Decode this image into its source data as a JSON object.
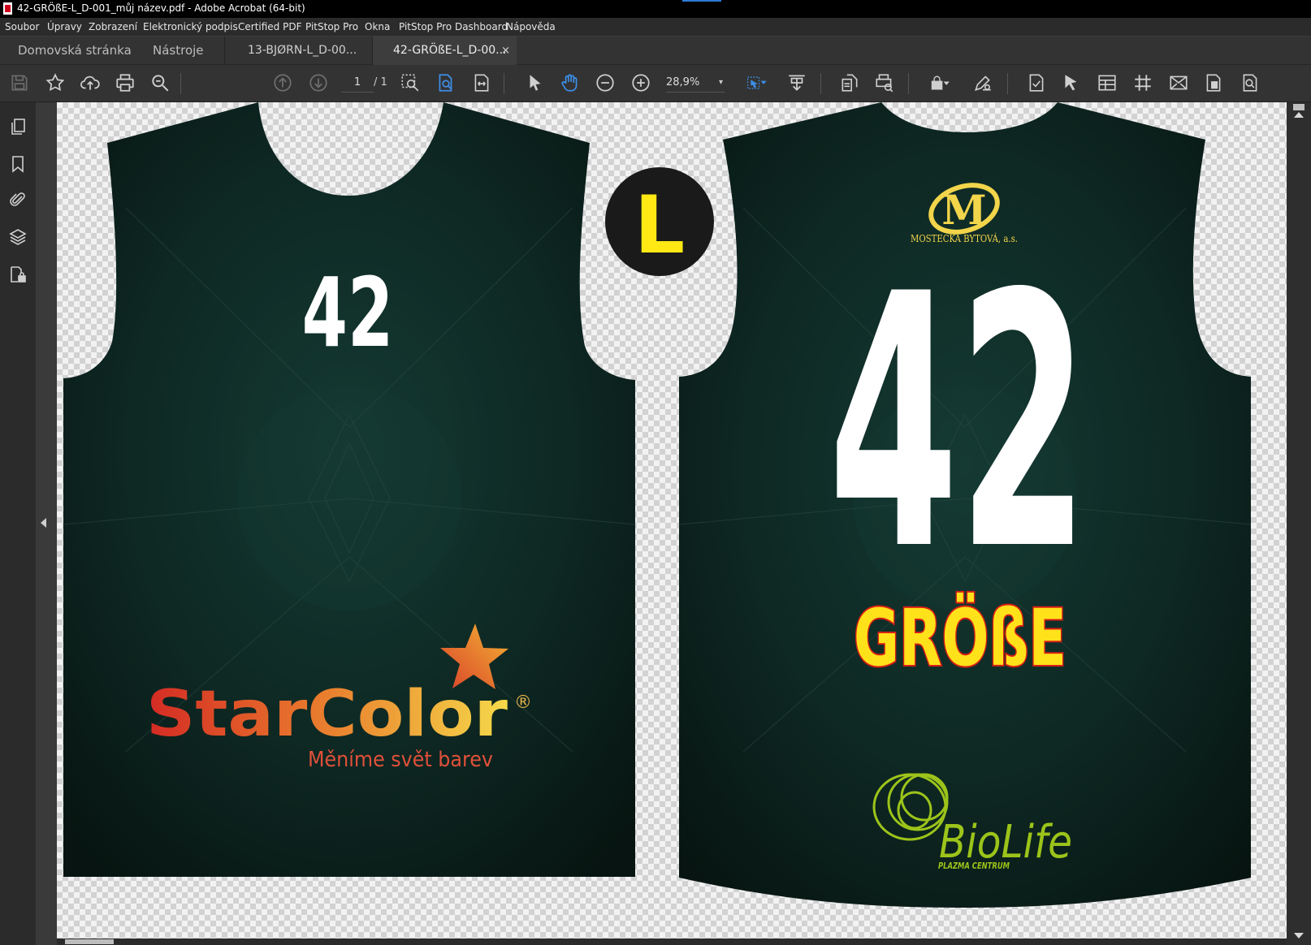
{
  "window": {
    "title": "42-GRÖßE-L_D-001_můj název.pdf - Adobe Acrobat (64-bit)"
  },
  "menu": {
    "items": [
      "Soubor",
      "Úpravy",
      "Zobrazení",
      "Elektronický podpis",
      "Certified PDF",
      "PitStop Pro",
      "Okna",
      "PitStop Pro Dashboard",
      "Nápověda"
    ]
  },
  "tabs": {
    "home": "Domovská stránka",
    "tools": "Nástroje",
    "doc1": "13-BJØRN-L_D-00...",
    "doc2": "42-GRÖßE-L_D-00...",
    "close_glyph": "×"
  },
  "toolbar": {
    "page_current": "1",
    "page_total": "/ 1",
    "zoom": "28,9%",
    "zoom_arrow": "▾",
    "icons": [
      "save-icon",
      "bookmark-star-icon",
      "upload-cloud-icon",
      "print-icon",
      "zoom-search-icon",
      "page-up-icon",
      "page-down-icon",
      "marquee-zoom-icon",
      "find-text-icon",
      "fit-page-icon",
      "select-arrow-icon",
      "hand-tool-icon",
      "zoom-out-icon",
      "zoom-in-icon",
      "interactive-tool-icon",
      "scroll-mode-icon",
      "rotate-page-icon",
      "print-production-icon",
      "lock-icon",
      "sign-icon",
      "preflight-icon",
      "select-object-icon",
      "table-edit-icon",
      "grid-icon",
      "envelope-icon",
      "document-icon",
      "document-search-icon"
    ]
  },
  "leftrail": {
    "icons": [
      "pages-icon",
      "bookmark-icon",
      "attachment-icon",
      "layers-icon",
      "security-icon"
    ]
  },
  "document": {
    "size_badge": "L",
    "front": {
      "number": "42",
      "sponsor": "StarColor",
      "sponsor_mark": "®",
      "tagline": "Měníme svět barev"
    },
    "back": {
      "number": "42",
      "name": "GRÖßE",
      "top_logo_letter": "M",
      "top_logo_text": "MOSTECKÁ BYTOVÁ, a.s.",
      "bottom_logo": "BioLife",
      "bottom_logo_sub": "PLAZMA CENTRUM"
    }
  },
  "colors": {
    "jersey": "#0d2420",
    "jersey_dark": "#081512",
    "white": "#ffffff",
    "yellow": "#ffe814",
    "gold": "#f2d54a",
    "red_outline": "#d81e15",
    "lime": "#9cc41a",
    "badge": "#1a1a1a"
  }
}
